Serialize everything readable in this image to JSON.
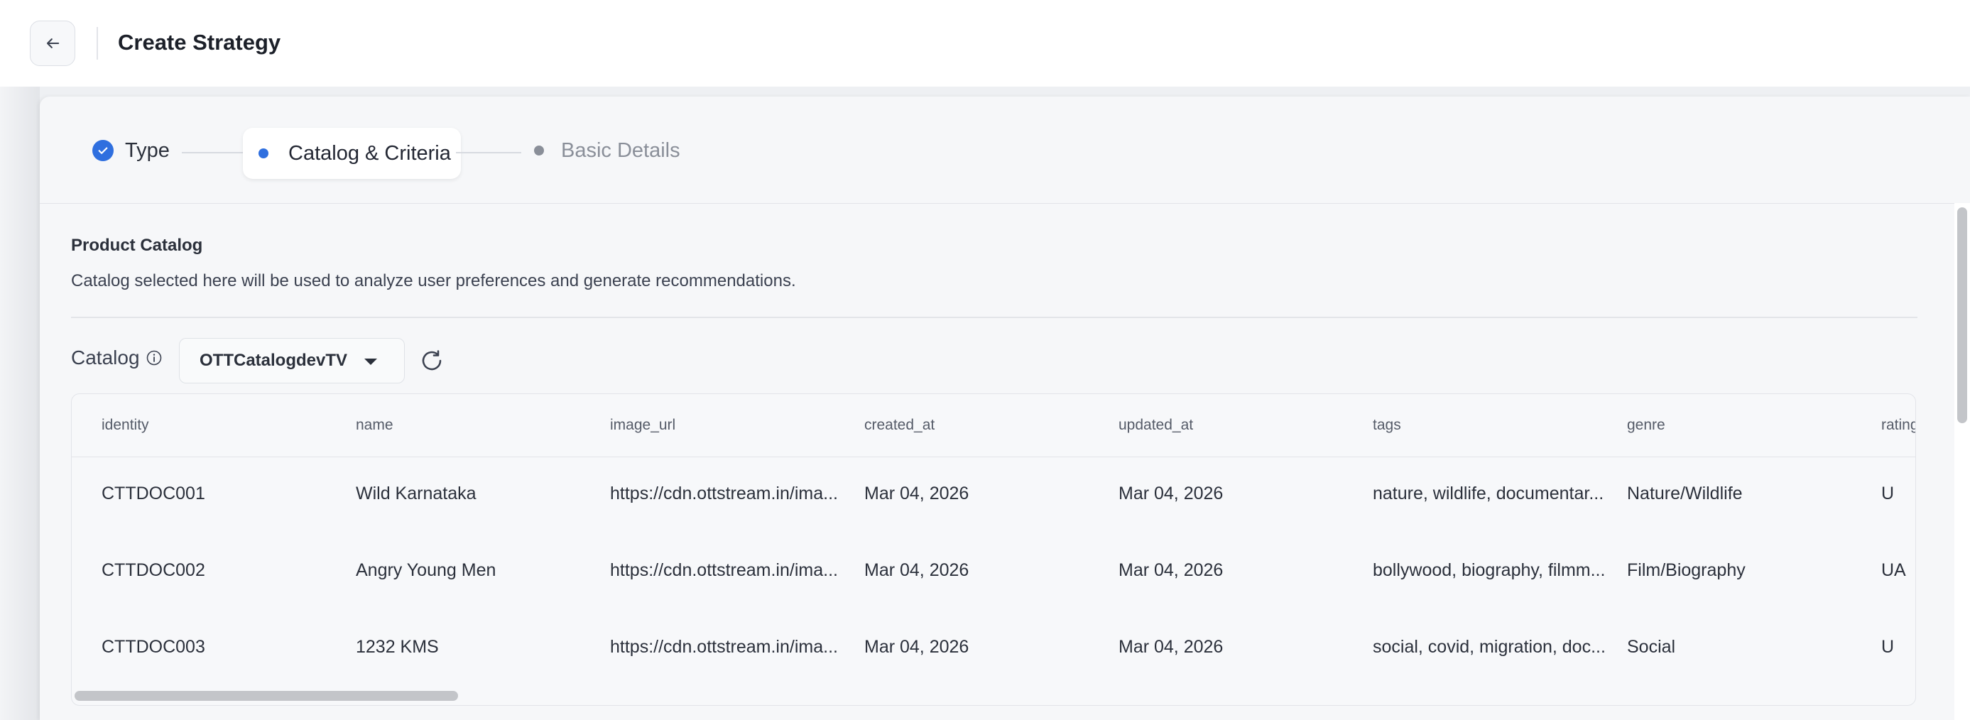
{
  "header": {
    "title": "Create Strategy",
    "back_icon": "arrow-left-icon"
  },
  "stepper": {
    "steps": [
      {
        "label": "Type",
        "state": "done"
      },
      {
        "label": "Catalog & Criteria",
        "state": "active"
      },
      {
        "label": "Basic Details",
        "state": "pending"
      }
    ]
  },
  "section": {
    "title": "Product Catalog",
    "description": "Catalog selected here will be used to analyze user preferences and generate recommendations."
  },
  "catalog": {
    "label": "Catalog",
    "selected": "OTTCatalogdevTV"
  },
  "table": {
    "columns": [
      "identity",
      "name",
      "image_url",
      "created_at",
      "updated_at",
      "tags",
      "genre",
      "rating"
    ],
    "rows": [
      [
        "CTTDOC001",
        "Wild Karnataka",
        "https://cdn.ottstream.in/ima...",
        "Mar 04, 2026",
        "Mar 04, 2026",
        "nature, wildlife, documentar...",
        "Nature/Wildlife",
        "U"
      ],
      [
        "CTTDOC002",
        "Angry Young Men",
        "https://cdn.ottstream.in/ima...",
        "Mar 04, 2026",
        "Mar 04, 2026",
        "bollywood, biography, filmm...",
        "Film/Biography",
        "UA"
      ],
      [
        "CTTDOC003",
        "1232 KMS",
        "https://cdn.ottstream.in/ima...",
        "Mar 04, 2026",
        "Mar 04, 2026",
        "social, covid, migration, doc...",
        "Social",
        "U"
      ]
    ]
  },
  "colors": {
    "accent": "#2f6fdf",
    "pending": "#8a8f99"
  }
}
